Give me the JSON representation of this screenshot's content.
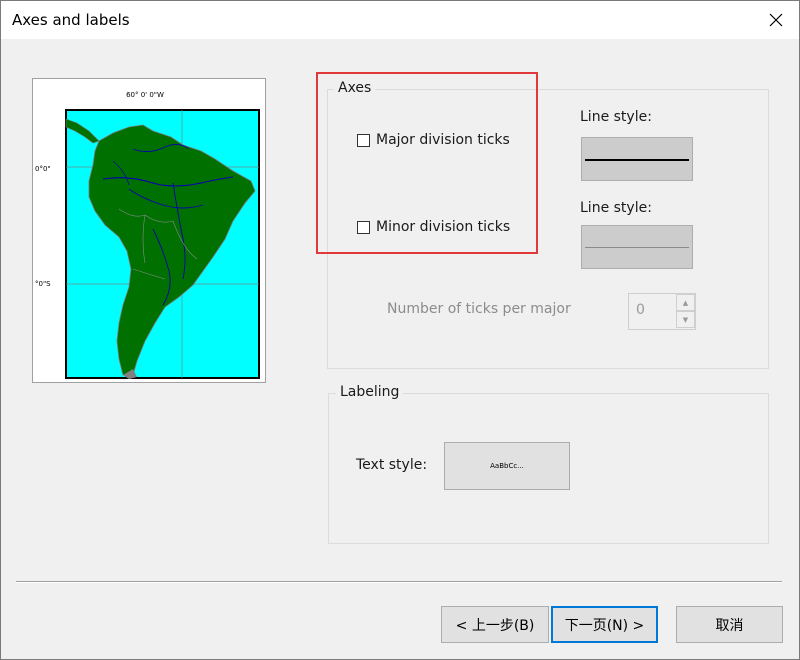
{
  "window": {
    "title": "Axes and labels"
  },
  "preview": {
    "top_label": "60° 0' 0\"W",
    "left_label_1": "0°0\"",
    "left_label_2": "°0\"S"
  },
  "axes": {
    "group_label": "Axes",
    "major_ticks_label": "Major division ticks",
    "major_ticks_checked": false,
    "minor_ticks_label": "Minor division ticks",
    "minor_ticks_checked": false,
    "major_line_style_label": "Line style:",
    "minor_line_style_label": "Line style:",
    "ticks_per_major_label": "Number of ticks per major",
    "ticks_per_major_value": "0"
  },
  "labeling": {
    "group_label": "Labeling",
    "text_style_label": "Text style:",
    "text_style_sample": "AaBbCc..."
  },
  "buttons": {
    "back": "< 上一步(B)",
    "next": "下一页(N) >",
    "cancel": "取消"
  },
  "colors": {
    "ocean": "#00ffff",
    "land": "#007000",
    "highlight": "#e0393c",
    "focus": "#0078d7"
  }
}
